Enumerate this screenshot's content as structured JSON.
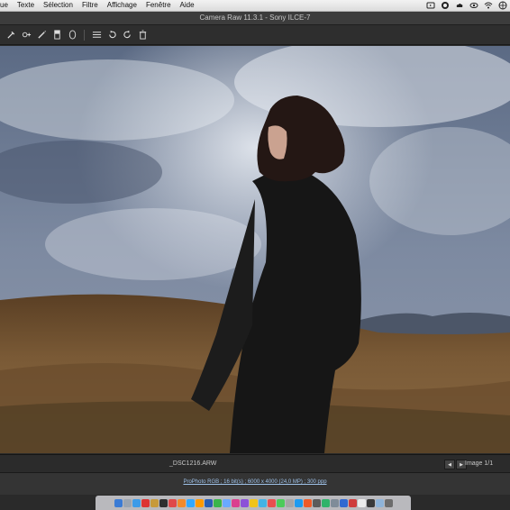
{
  "menubar": {
    "items": [
      "ue",
      "Texte",
      "Sélection",
      "Filtre",
      "Affichage",
      "Fenêtre",
      "Aide"
    ]
  },
  "window": {
    "title": "Camera Raw 11.3.1  -  Sony ILCE-7"
  },
  "toolbar": {
    "tools": [
      {
        "icon": "white-balance-icon"
      },
      {
        "icon": "targeted-adjustment-icon"
      },
      {
        "icon": "adjustment-brush-icon"
      },
      {
        "icon": "graduated-filter-icon"
      },
      {
        "icon": "radial-filter-icon"
      },
      {
        "icon": "preferences-list-icon"
      },
      {
        "icon": "rotate-left-icon"
      },
      {
        "icon": "rotate-right-icon"
      },
      {
        "icon": "trash-icon"
      }
    ]
  },
  "filmstrip": {
    "filename": "_DSC1216.ARW",
    "image_count": "Image 1/1"
  },
  "workflow_options": "ProPhoto RGB ; 16 bit(s) ; 6000 x 4000 (24,0 MP) ; 300 ppp",
  "colors": {
    "accent_link": "#9ec1e8",
    "panel": "#2e2e2e",
    "menubar": "#e8e8e8"
  }
}
